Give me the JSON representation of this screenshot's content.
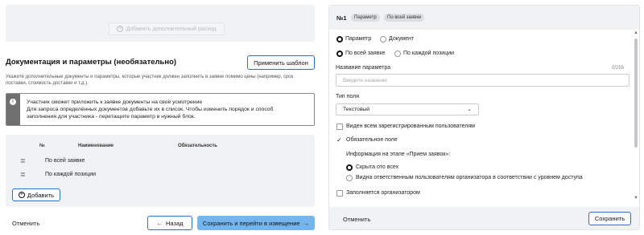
{
  "left": {
    "add_extra_expense": "Добавить дополнительный расход",
    "section_title": "Документация и параметры (необязательно)",
    "apply_template": "Применить шаблон",
    "section_desc": "Укажите дополнительные документы и параметры, которые участник должен заполнить в заявке помимо цены (например, срок поставки, стоимость доставки и т.д.).",
    "info_lines": [
      "Участник сможет приложить к заявке документы на своё усмотрение",
      "Для запроса определённых документов добавьте их в список. Чтобы изменить порядок и способ",
      "заполнения для участника - перетащите параметр в нужный блок."
    ],
    "table_headers": {
      "num": "№",
      "name": "Наименование",
      "required": "Обязательность"
    },
    "rows": [
      {
        "name": "По всей заявке"
      },
      {
        "name": "По каждой позиции"
      }
    ],
    "add_button": "Добавить",
    "cancel": "Отменить",
    "back": "Назад",
    "save_next": "Сохранить и перейти в извещение"
  },
  "right": {
    "header": {
      "number": "№1",
      "badges": [
        "Параметр",
        "По всей заявке"
      ]
    },
    "type_options": [
      "Параметр",
      "Документ"
    ],
    "type_selected": "Параметр",
    "scope_options": [
      "По всей заявке",
      "По каждой позиции"
    ],
    "scope_selected": "По всей заявке",
    "name_label": "Название параметра",
    "name_counter": "0/255",
    "name_placeholder": "Введите название",
    "field_type_label": "Тип поля",
    "field_type_value": "Текстовый",
    "visible_all": {
      "label": "Виден всем зарегистрированным пользователям",
      "checked": false
    },
    "required": {
      "label": "Обязательное поле",
      "checked": true
    },
    "stage_info": "Информация на этапе «Прием заявок»:",
    "visibility_options": [
      "Скрыта ото всех",
      "Видна ответственным пользователям организатора в соответствии с уровнем доступа"
    ],
    "visibility_selected": "Скрыта ото всех",
    "filled_by_org": {
      "label": "Заполняется организатором",
      "checked": false
    },
    "cancel": "Отменить",
    "save": "Сохранить"
  },
  "icons": {
    "plus_circle": "plus-circle-icon",
    "info": "info-icon",
    "drag": "drag-handle-icon",
    "arrow_left": "arrow-left-icon",
    "arrow_right": "arrow-right-icon",
    "chevron_down": "chevron-down-icon",
    "check": "check-icon"
  },
  "colors": {
    "accent": "#2a6fce",
    "primary_button": "#75b5ee",
    "panel_bg": "#f1f2f4"
  }
}
